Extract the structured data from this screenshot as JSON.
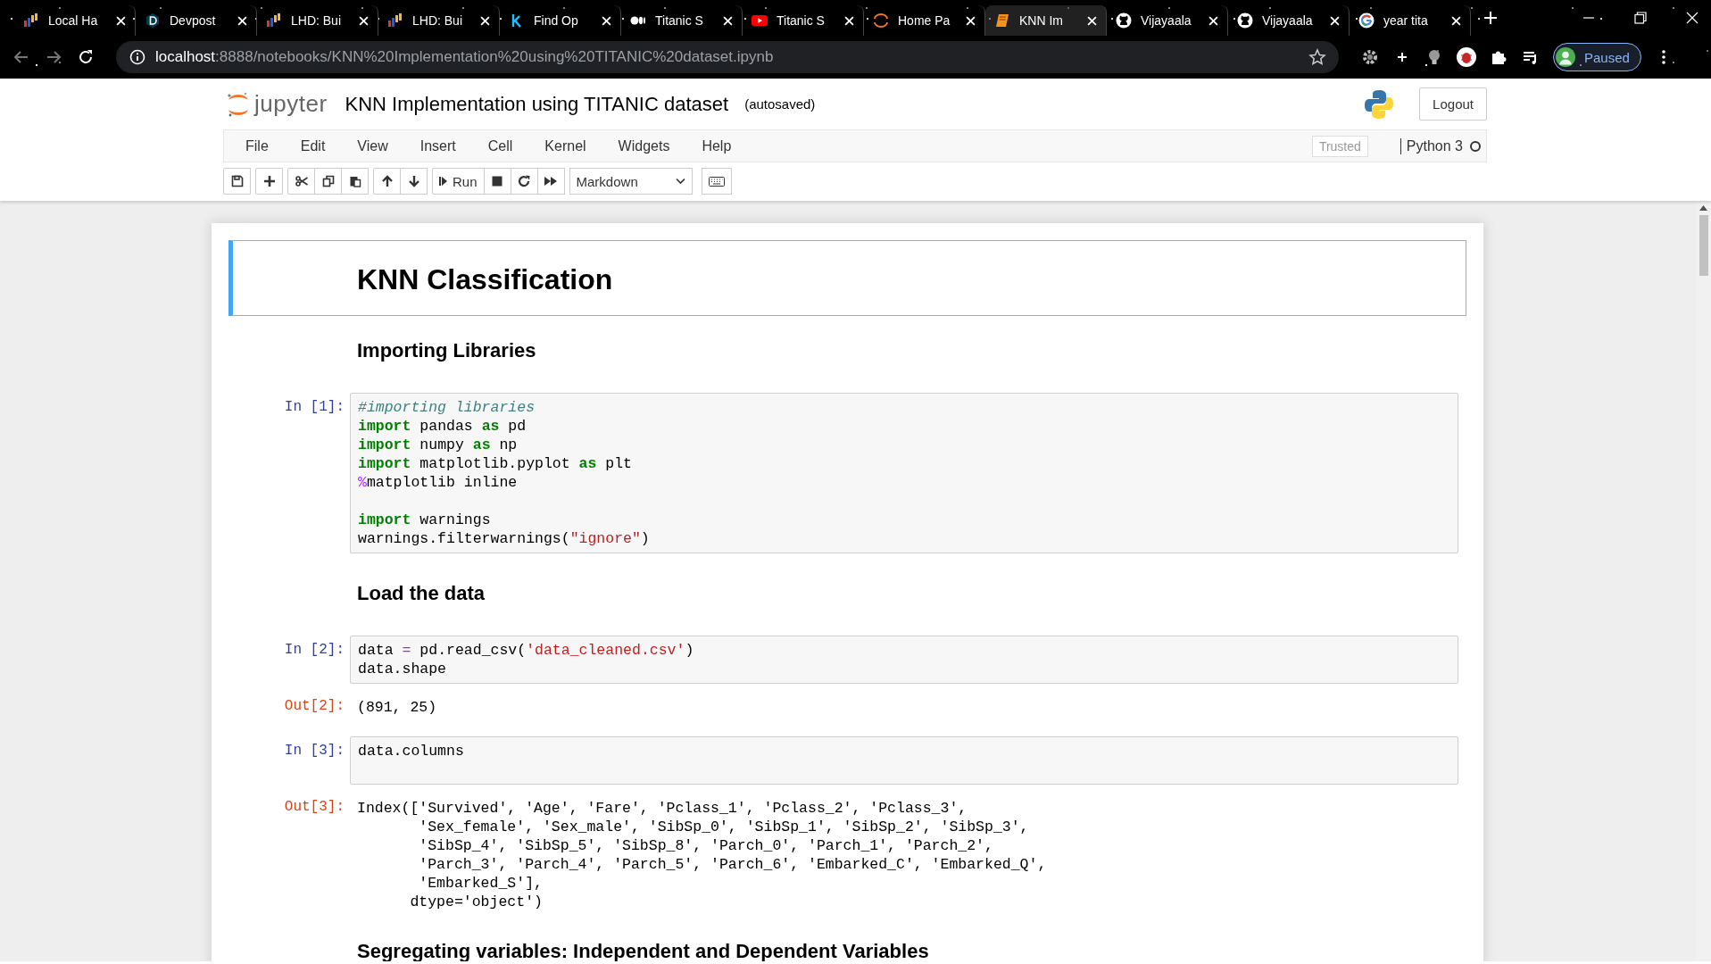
{
  "browser": {
    "tabs": [
      {
        "title": "Local Ha",
        "kind": "mlh",
        "selected": false
      },
      {
        "title": "Devpost",
        "kind": "devpost",
        "selected": false
      },
      {
        "title": "LHD: Bui",
        "kind": "mlh",
        "selected": false
      },
      {
        "title": "LHD: Bui",
        "kind": "mlh",
        "selected": false
      },
      {
        "title": "Find Op",
        "kind": "kaggle",
        "selected": false
      },
      {
        "title": "Titanic S",
        "kind": "medium",
        "selected": false
      },
      {
        "title": "Titanic S",
        "kind": "youtube",
        "selected": false
      },
      {
        "title": "Home Pa",
        "kind": "ring",
        "selected": false
      },
      {
        "title": "KNN Im",
        "kind": "book",
        "selected": true
      },
      {
        "title": "Vijayaala",
        "kind": "github",
        "selected": false
      },
      {
        "title": "Vijayaala",
        "kind": "github",
        "selected": false
      },
      {
        "title": "year tita",
        "kind": "google",
        "selected": false
      }
    ],
    "address": {
      "host": "localhost",
      "path": ":8888/notebooks/KNN%20Implementation%20using%20TITANIC%20dataset.ipynb"
    },
    "profile": {
      "label": "Paused"
    }
  },
  "header": {
    "logo_text": "jupyter",
    "notebook_title": "KNN Implementation using TITANIC dataset",
    "save_status": "(autosaved)",
    "logout": "Logout"
  },
  "menu": {
    "items": [
      "File",
      "Edit",
      "View",
      "Insert",
      "Cell",
      "Kernel",
      "Widgets",
      "Help"
    ],
    "trusted": "Trusted",
    "kernel": {
      "name": "Python 3",
      "busy": false
    }
  },
  "toolbar": {
    "groups": [
      [
        {
          "kind": "save"
        }
      ],
      [
        {
          "kind": "insert"
        }
      ],
      [
        {
          "kind": "cut"
        },
        {
          "kind": "copy"
        },
        {
          "kind": "paste"
        }
      ],
      [
        {
          "kind": "up"
        },
        {
          "kind": "down"
        }
      ],
      [
        {
          "kind": "run",
          "label": "Run"
        },
        {
          "kind": "stop"
        },
        {
          "kind": "restart"
        },
        {
          "kind": "run-all"
        }
      ]
    ],
    "cell_type": "Markdown"
  },
  "cells": [
    {
      "kind": "title",
      "text": "KNN Classification",
      "selected": true
    },
    {
      "kind": "heading",
      "text": "Importing Libraries",
      "selected": false
    },
    {
      "kind": "code",
      "prompt": "In [1]:",
      "lines": [
        {
          "kind": "code",
          "tokens": [
            {
              "t": "#importing libraries",
              "kind": "comment"
            }
          ]
        },
        {
          "kind": "code",
          "tokens": [
            {
              "t": "import",
              "kind": "keyword"
            },
            {
              "t": " pandas ",
              "kind": "plain"
            },
            {
              "t": "as",
              "kind": "keyword"
            },
            {
              "t": " pd",
              "kind": "plain"
            }
          ]
        },
        {
          "kind": "code",
          "tokens": [
            {
              "t": "import",
              "kind": "keyword"
            },
            {
              "t": " numpy ",
              "kind": "plain"
            },
            {
              "t": "as",
              "kind": "keyword"
            },
            {
              "t": " np",
              "kind": "plain"
            }
          ]
        },
        {
          "kind": "code",
          "tokens": [
            {
              "t": "import",
              "kind": "keyword"
            },
            {
              "t": " matplotlib.pyplot ",
              "kind": "plain"
            },
            {
              "t": "as",
              "kind": "keyword"
            },
            {
              "t": " plt",
              "kind": "plain"
            }
          ]
        },
        {
          "kind": "code",
          "tokens": [
            {
              "t": "%",
              "kind": "operator"
            },
            {
              "t": "matplotlib inline",
              "kind": "plain"
            }
          ]
        },
        {
          "kind": "blank"
        },
        {
          "kind": "code",
          "tokens": [
            {
              "t": "import",
              "kind": "keyword"
            },
            {
              "t": " warnings",
              "kind": "plain"
            }
          ]
        },
        {
          "kind": "code",
          "tokens": [
            {
              "t": "warnings.filterwarnings(",
              "kind": "plain"
            },
            {
              "t": "\"ignore\"",
              "kind": "string"
            },
            {
              "t": ")",
              "kind": "plain"
            }
          ]
        }
      ]
    },
    {
      "kind": "heading",
      "text": "Load the data",
      "selected": false
    },
    {
      "kind": "code",
      "prompt": "In [2]:",
      "lines": [
        {
          "kind": "code",
          "tokens": [
            {
              "t": "data ",
              "kind": "plain"
            },
            {
              "t": "=",
              "kind": "operator"
            },
            {
              "t": " pd.read_csv(",
              "kind": "plain"
            },
            {
              "t": "'data_cleaned.csv'",
              "kind": "string"
            },
            {
              "t": ")",
              "kind": "plain"
            }
          ]
        },
        {
          "kind": "code",
          "tokens": [
            {
              "t": "data.shape",
              "kind": "plain"
            }
          ]
        }
      ],
      "output": {
        "prompt": "Out[2]:",
        "lines": [
          "(891, 25)"
        ]
      }
    },
    {
      "kind": "code",
      "prompt": "In [3]:",
      "lines": [
        {
          "kind": "code",
          "tokens": [
            {
              "t": "data.columns",
              "kind": "plain"
            }
          ]
        },
        {
          "kind": "blank"
        }
      ],
      "output": {
        "prompt": "Out[3]:",
        "lines": [
          "Index(['Survived', 'Age', 'Fare', 'Pclass_1', 'Pclass_2', 'Pclass_3',",
          "       'Sex_female', 'Sex_male', 'SibSp_0', 'SibSp_1', 'SibSp_2', 'SibSp_3',",
          "       'SibSp_4', 'SibSp_5', 'SibSp_8', 'Parch_0', 'Parch_1', 'Parch_2',",
          "       'Parch_3', 'Parch_4', 'Parch_5', 'Parch_6', 'Embarked_C', 'Embarked_Q',",
          "       'Embarked_S'],",
          "      dtype='object')"
        ]
      }
    },
    {
      "kind": "heading",
      "text": "Segregating variables: Independent and Dependent Variables",
      "selected": false
    }
  ]
}
